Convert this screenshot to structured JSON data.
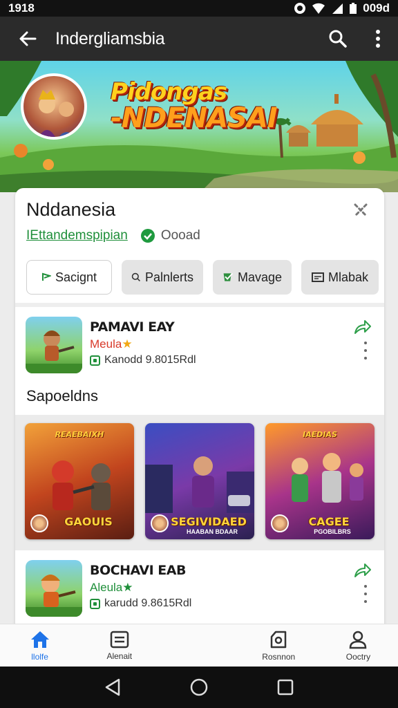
{
  "status_bar": {
    "time": "1918",
    "battery": "009d"
  },
  "app_bar": {
    "title": "Indergliamsbia"
  },
  "banner": {
    "title_line1": "Pidongas",
    "title_line2": "-NDENASAI"
  },
  "card": {
    "title": "Nddanesia",
    "developer": "IEttandemspipian",
    "rating_label": "Oooad",
    "chips": [
      {
        "label": "Sacignt",
        "icon": "flag-icon",
        "selected": true
      },
      {
        "label": "Palnlerts",
        "icon": "search-icon",
        "selected": false
      },
      {
        "label": "Mavage",
        "icon": "check-shield-icon",
        "selected": false
      },
      {
        "label": "Mlabak",
        "icon": "card-icon",
        "selected": false
      }
    ]
  },
  "apps": [
    {
      "name": "PAMAVI EAY",
      "tag": "Meula",
      "meta": "Kanodd 9.8015Rdl",
      "tag_color": "#d83a2a"
    },
    {
      "name": "BOCHAVI EAB",
      "tag": "Aleula",
      "meta": "karudd 9.8615Rdl",
      "tag_color": "#1f8f3a"
    }
  ],
  "section": {
    "title": "Sapoeldns"
  },
  "tiles": [
    {
      "top": "REAEBAIXH",
      "label": "GAOUIS",
      "sub": "",
      "bg": "linear-gradient(160deg,#f2a23a 0%,#c2451e 50%,#5a1e12 100%)"
    },
    {
      "top": "",
      "label": "SEGIVIDAED",
      "sub": "HAABAN BDAAR",
      "bg": "linear-gradient(160deg,#3a4ec2 0%,#7a3aa8 50%,#2a2050 100%)"
    },
    {
      "top": "IAEDIAS",
      "label": "CAGEE",
      "sub": "PGOBILBRS",
      "bg": "linear-gradient(160deg,#ff9a2a 0%,#a8348a 50%,#3a1a5a 100%)"
    }
  ],
  "bottom_nav": [
    {
      "label": "llolfe",
      "icon": "home-icon",
      "active": true
    },
    {
      "label": "Alenait",
      "icon": "list-icon",
      "active": false
    },
    {
      "label": "",
      "icon": "",
      "active": false
    },
    {
      "label": "Rosnnon",
      "icon": "camera-icon",
      "active": false
    },
    {
      "label": "Ooctry",
      "icon": "person-icon",
      "active": false
    }
  ]
}
